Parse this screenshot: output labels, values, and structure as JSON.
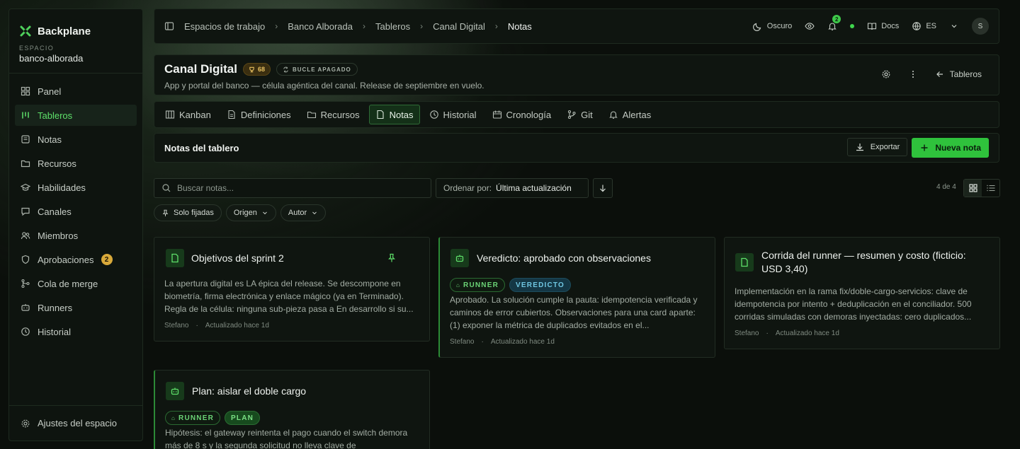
{
  "sidebar": {
    "brand": "Backplane",
    "workspace_label": "ESPACIO",
    "workspace_name": "banco-alborada",
    "items": [
      {
        "label": "Panel",
        "icon": "grid-icon"
      },
      {
        "label": "Tableros",
        "icon": "columns-icon"
      },
      {
        "label": "Notas",
        "icon": "note-icon"
      },
      {
        "label": "Recursos",
        "icon": "folder-icon"
      },
      {
        "label": "Habilidades",
        "icon": "graduation-icon"
      },
      {
        "label": "Canales",
        "icon": "chat-icon"
      },
      {
        "label": "Miembros",
        "icon": "users-icon"
      },
      {
        "label": "Aprobaciones",
        "icon": "shield-icon",
        "badge": "2"
      },
      {
        "label": "Cola de merge",
        "icon": "merge-icon"
      },
      {
        "label": "Runners",
        "icon": "runner-icon"
      },
      {
        "label": "Historial",
        "icon": "clock-icon"
      }
    ],
    "active": "Tableros",
    "settings_label": "Ajustes del espacio"
  },
  "topbar": {
    "breadcrumbs": [
      "Espacios de trabajo",
      "Banco Alborada",
      "Tableros",
      "Canal Digital",
      "Notas"
    ],
    "theme_label": "Oscuro",
    "notifications_count": "2",
    "docs_label": "Docs",
    "language": "ES",
    "avatar_initial": "S"
  },
  "board": {
    "title": "Canal Digital",
    "score": "68",
    "loop_status": "BUCLE APAGADO",
    "description": "App y portal del banco — célula agéntica del canal. Release de septiembre en vuelo.",
    "back_label": "Tableros"
  },
  "tabs": [
    {
      "label": "Kanban",
      "icon": "kanban-icon"
    },
    {
      "label": "Definiciones",
      "icon": "document-icon"
    },
    {
      "label": "Recursos",
      "icon": "folder-icon"
    },
    {
      "label": "Notas",
      "icon": "note-icon"
    },
    {
      "label": "Historial",
      "icon": "clock-icon"
    },
    {
      "label": "Cronología",
      "icon": "timeline-icon"
    },
    {
      "label": "Git",
      "icon": "git-icon"
    },
    {
      "label": "Alertas",
      "icon": "bell-icon"
    }
  ],
  "active_tab": "Notas",
  "notes": {
    "heading": "Notas del tablero",
    "export_label": "Exportar",
    "new_label": "Nueva nota",
    "search_placeholder": "Buscar notas...",
    "sort_label": "Ordenar por:",
    "sort_value": "Última actualización",
    "count": "4 de 4",
    "filters": [
      "Solo fijadas",
      "Origen",
      "Autor"
    ]
  },
  "cards": [
    {
      "title": "Objetivos del sprint 2",
      "icon": "note-icon",
      "pinned": true,
      "body": "La apertura digital es LA épica del release. Se descompone en biometría, firma electrónica y enlace mágico (ya en Terminado). Regla de la célula: ninguna sub-pieza pasa a En desarrollo si su...",
      "author": "Stefano",
      "updated": "Actualizado hace 1d"
    },
    {
      "title": "Veredicto: aprobado con observaciones",
      "icon": "robot-icon",
      "tags": [
        "RUNNER",
        "VEREDICTO"
      ],
      "body": "Aprobado. La solución cumple la pauta: idempotencia verificada y caminos de error cubiertos. Observaciones para una card aparte: (1) exponer la métrica de duplicados evitados en el...",
      "author": "Stefano",
      "updated": "Actualizado hace 1d"
    },
    {
      "title": "Corrida del runner — resumen y costo (ficticio: USD 3,40)",
      "icon": "note-icon",
      "body": "Implementación en la rama fix/doble-cargo-servicios: clave de idempotencia por intento + deduplicación en el conciliador. 500 corridas simuladas con demoras inyectadas: cero duplicados...",
      "author": "Stefano",
      "updated": "Actualizado hace 1d"
    },
    {
      "title": "Plan: aislar el doble cargo",
      "icon": "robot-icon",
      "tags": [
        "RUNNER",
        "PLAN"
      ],
      "body": "Hipótesis: el gateway reintenta el pago cuando el switch demora más de 8 s y la segunda solicitud no lleva clave de",
      "author": "",
      "updated": ""
    }
  ],
  "colors": {
    "accent": "#2fc23c",
    "accent_text": "#5ee06a",
    "badge": "#d8a93a",
    "verdict": "#6fc7e2"
  }
}
